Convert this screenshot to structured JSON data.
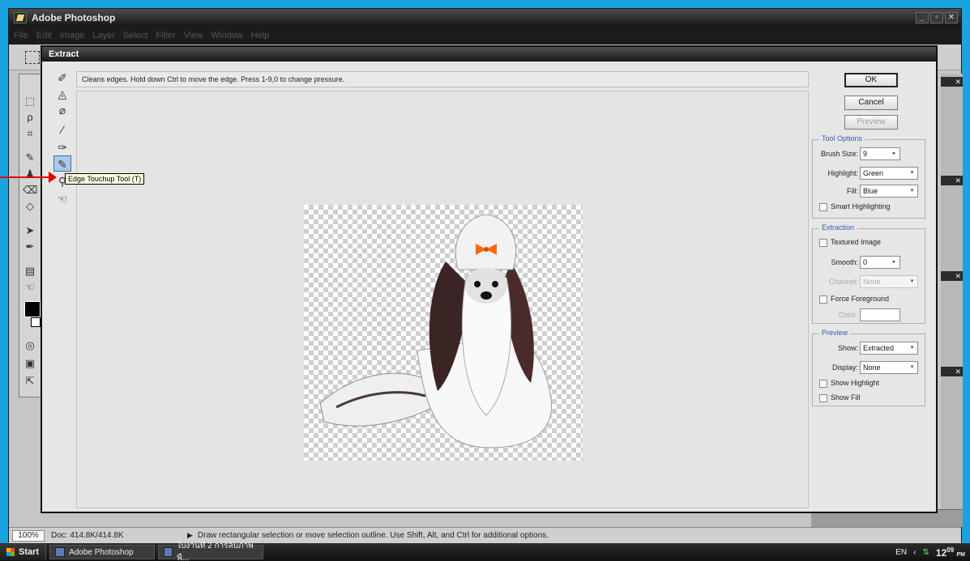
{
  "app": {
    "title": "Adobe Photoshop"
  },
  "menu": [
    "File",
    "Edit",
    "Image",
    "Layer",
    "Select",
    "Filter",
    "View",
    "Window",
    "Help"
  ],
  "dialog": {
    "title": "Extract",
    "hint": "Cleans edges. Hold down Ctrl to move the edge. Press 1-9,0 to change pressure.",
    "tooltip": "Edge Touchup Tool (T)",
    "buttons": {
      "ok": "OK",
      "cancel": "Cancel",
      "preview": "Preview"
    },
    "tool_options": {
      "title": "Tool Options",
      "brush_size_label": "Brush Size:",
      "brush_size": "9",
      "highlight_label": "Highlight:",
      "highlight": "Green",
      "fill_label": "Fill:",
      "fill": "Blue",
      "smart_highlighting": "Smart Highlighting"
    },
    "extraction": {
      "title": "Extraction",
      "textured_image": "Textured Image",
      "smooth_label": "Smooth:",
      "smooth": "0",
      "channel_label": "Channel:",
      "channel": "None",
      "force_foreground": "Force Foreground",
      "color_label": "Color:"
    },
    "preview": {
      "title": "Preview",
      "show_label": "Show:",
      "show": "Extracted",
      "display_label": "Display:",
      "display": "None",
      "show_highlight": "Show Highlight",
      "show_fill": "Show Fill"
    }
  },
  "status": {
    "zoom": "100%",
    "doc": "Doc: 414.8K/414.8K",
    "message": "Draw rectangular selection or move selection outline.  Use Shift, Alt, and Ctrl for additional options."
  },
  "taskbar": {
    "start": "Start",
    "items": [
      "Adobe Photoshop",
      "ใบงานที่ 2 การลบภาพพื..."
    ],
    "lang": "EN",
    "time": "12",
    "time_min": "09",
    "ampm": "PM"
  }
}
